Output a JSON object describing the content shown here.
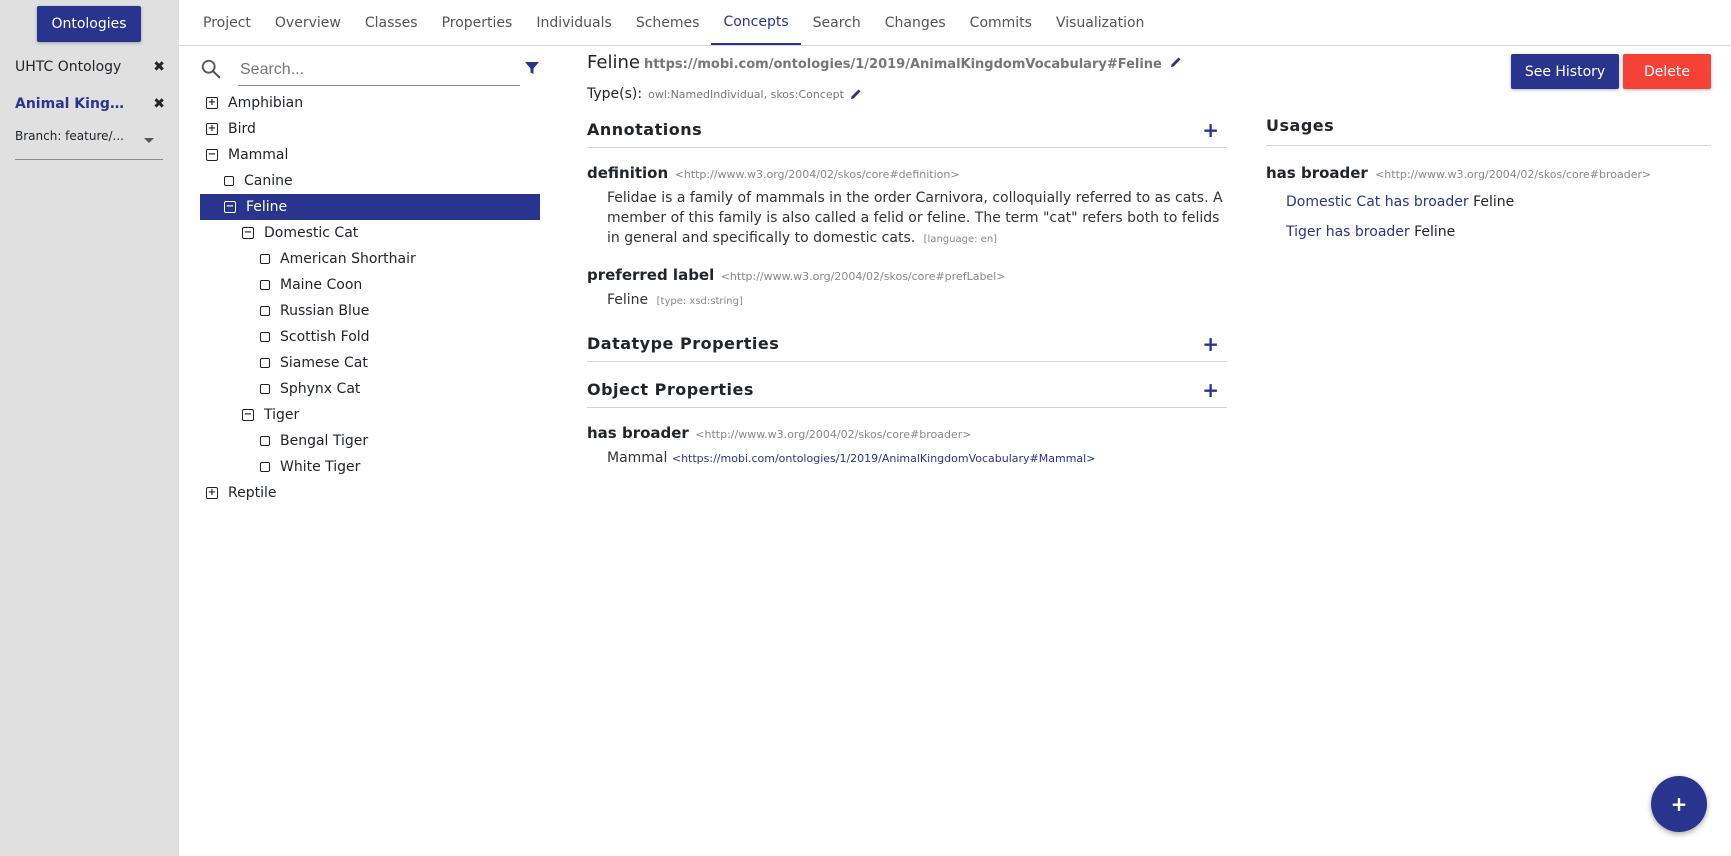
{
  "sidebar": {
    "ontologies_button": "Ontologies",
    "open_ontologies": [
      {
        "name": "UHTC Ontology",
        "active": false
      },
      {
        "name": "Animal Kingdom Vocabulary",
        "display": "Animal Kingdo...",
        "active": true
      }
    ],
    "branch_label": "Branch: feature/..."
  },
  "tabs": [
    "Project",
    "Overview",
    "Classes",
    "Properties",
    "Individuals",
    "Schemes",
    "Concepts",
    "Search",
    "Changes",
    "Commits",
    "Visualization"
  ],
  "active_tab": "Concepts",
  "search": {
    "placeholder": "Search..."
  },
  "tree": [
    {
      "label": "Amphibian",
      "level": 0,
      "symbol": "+"
    },
    {
      "label": "Bird",
      "level": 0,
      "symbol": "+"
    },
    {
      "label": "Mammal",
      "level": 0,
      "symbol": "−"
    },
    {
      "label": "Canine",
      "level": 1,
      "symbol": ""
    },
    {
      "label": "Feline",
      "level": 1,
      "symbol": "−",
      "selected": true
    },
    {
      "label": "Domestic Cat",
      "level": 2,
      "symbol": "−"
    },
    {
      "label": "American Shorthair",
      "level": 3,
      "symbol": ""
    },
    {
      "label": "Maine Coon",
      "level": 3,
      "symbol": ""
    },
    {
      "label": "Russian Blue",
      "level": 3,
      "symbol": ""
    },
    {
      "label": "Scottish Fold",
      "level": 3,
      "symbol": ""
    },
    {
      "label": "Siamese Cat",
      "level": 3,
      "symbol": ""
    },
    {
      "label": "Sphynx Cat",
      "level": 3,
      "symbol": ""
    },
    {
      "label": "Tiger",
      "level": 2,
      "symbol": "−"
    },
    {
      "label": "Bengal Tiger",
      "level": 3,
      "symbol": ""
    },
    {
      "label": "White Tiger",
      "level": 3,
      "symbol": ""
    },
    {
      "label": "Reptile",
      "level": 0,
      "symbol": "+"
    }
  ],
  "entity": {
    "name": "Feline",
    "iri": "https://mobi.com/ontologies/1/2019/AnimalKingdomVocabulary#Feline",
    "types_label": "Type(s):",
    "types": "owl:NamedIndividual, skos:Concept"
  },
  "sections": {
    "annotations": "Annotations",
    "datatype": "Datatype Properties",
    "object": "Object Properties"
  },
  "annotations": {
    "definition": {
      "name": "definition",
      "iri": "<http://www.w3.org/2004/02/skos/core#definition>",
      "value": "Felidae is a family of mammals in the order Carnivora, colloquially referred to as cats. A member of this family is also called a felid or feline. The term \"cat\" refers both to felids in general and specifically to domestic cats.",
      "lang": "[language: en]"
    },
    "pref_label": {
      "name": "preferred label",
      "iri": "<http://www.w3.org/2004/02/skos/core#prefLabel>",
      "value": "Feline",
      "type": "[type: xsd:string]"
    }
  },
  "object_props": {
    "name": "has broader",
    "iri": "<http://www.w3.org/2004/02/skos/core#broader>",
    "value": "Mammal",
    "value_iri": "<https://mobi.com/ontologies/1/2019/AnimalKingdomVocabulary#Mammal>"
  },
  "buttons": {
    "history": "See History",
    "delete": "Delete",
    "fab": "+"
  },
  "usages": {
    "title": "Usages",
    "prop": "has broader",
    "prop_iri": "<http://www.w3.org/2004/02/skos/core#broader>",
    "items": [
      {
        "subject": "Domestic Cat has broader",
        "object": "Feline"
      },
      {
        "subject": "Tiger has broader",
        "object": "Feline"
      }
    ]
  },
  "colors": {
    "primary": "#29348f",
    "danger": "#f44336",
    "sidebar": "#e0e0e0"
  }
}
